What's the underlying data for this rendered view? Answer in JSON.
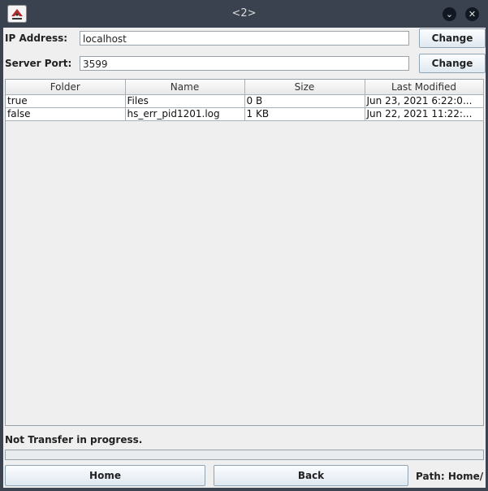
{
  "window": {
    "title": "<2>",
    "minimize_icon": "chevron-down-icon",
    "close_icon": "close-icon"
  },
  "connection": {
    "ip_label": "IP Address:",
    "ip_value": "localhost",
    "ip_change": "Change",
    "port_label": "Server Port:",
    "port_value": "3599",
    "port_change": "Change"
  },
  "table": {
    "columns": [
      "Folder",
      "Name",
      "Size",
      "Last Modified"
    ],
    "rows": [
      [
        "true",
        "Files",
        "0 B",
        "Jun 23, 2021 6:22:0..."
      ],
      [
        "false",
        "hs_err_pid1201.log",
        "1 KB",
        "Jun 22, 2021 11:22:..."
      ]
    ]
  },
  "status": {
    "text": "Not Transfer in progress.",
    "progress": 0
  },
  "footer": {
    "home": "Home",
    "back": "Back",
    "path": "Path: Home/"
  }
}
